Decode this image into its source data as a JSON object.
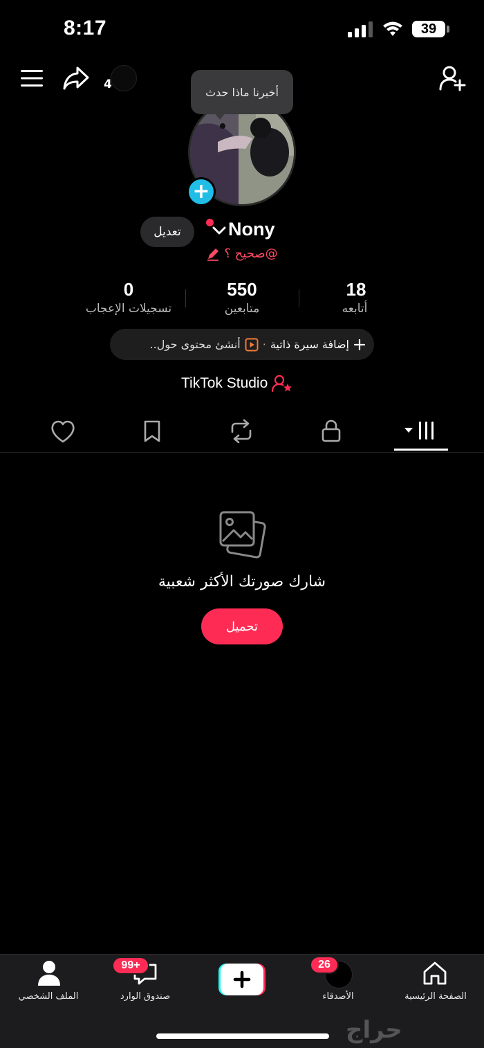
{
  "status_bar": {
    "time": "8:17",
    "battery": "39"
  },
  "top_bar": {
    "share_count": "4"
  },
  "tooltip": {
    "text": "أخبرنا ماذا حدث"
  },
  "profile": {
    "edit_label": "تعديل",
    "username": "Nony",
    "handle": "@صحيح ؟"
  },
  "stats": [
    {
      "value": "18",
      "label": "أتابعه"
    },
    {
      "value": "550",
      "label": "متابعين"
    },
    {
      "value": "0",
      "label": "تسجيلات الإعجاب"
    }
  ],
  "bio_pill": {
    "add_bio": "إضافة سيرة ذاتية",
    "separator": "·",
    "create_content": "أنشئ محتوى حول.."
  },
  "studio": {
    "label": "TikTok Studio"
  },
  "tabs": [
    "videos-icon",
    "lock-icon",
    "repost-icon",
    "bookmark-icon",
    "heart-icon"
  ],
  "empty_state": {
    "title": "شارك صورتك الأكثر شعبية",
    "upload_label": "تحميل"
  },
  "bottom_nav": {
    "profile": "الملف الشخصي",
    "inbox": "صندوق الوارد",
    "inbox_badge": "99+",
    "friends": "الأصدقاء",
    "friends_badge": "26",
    "home": "الصفحة الرئيسية"
  },
  "watermark": "حراج",
  "colors": {
    "accent": "#fe2c55",
    "cyan": "#20bde6",
    "background": "#000000"
  }
}
